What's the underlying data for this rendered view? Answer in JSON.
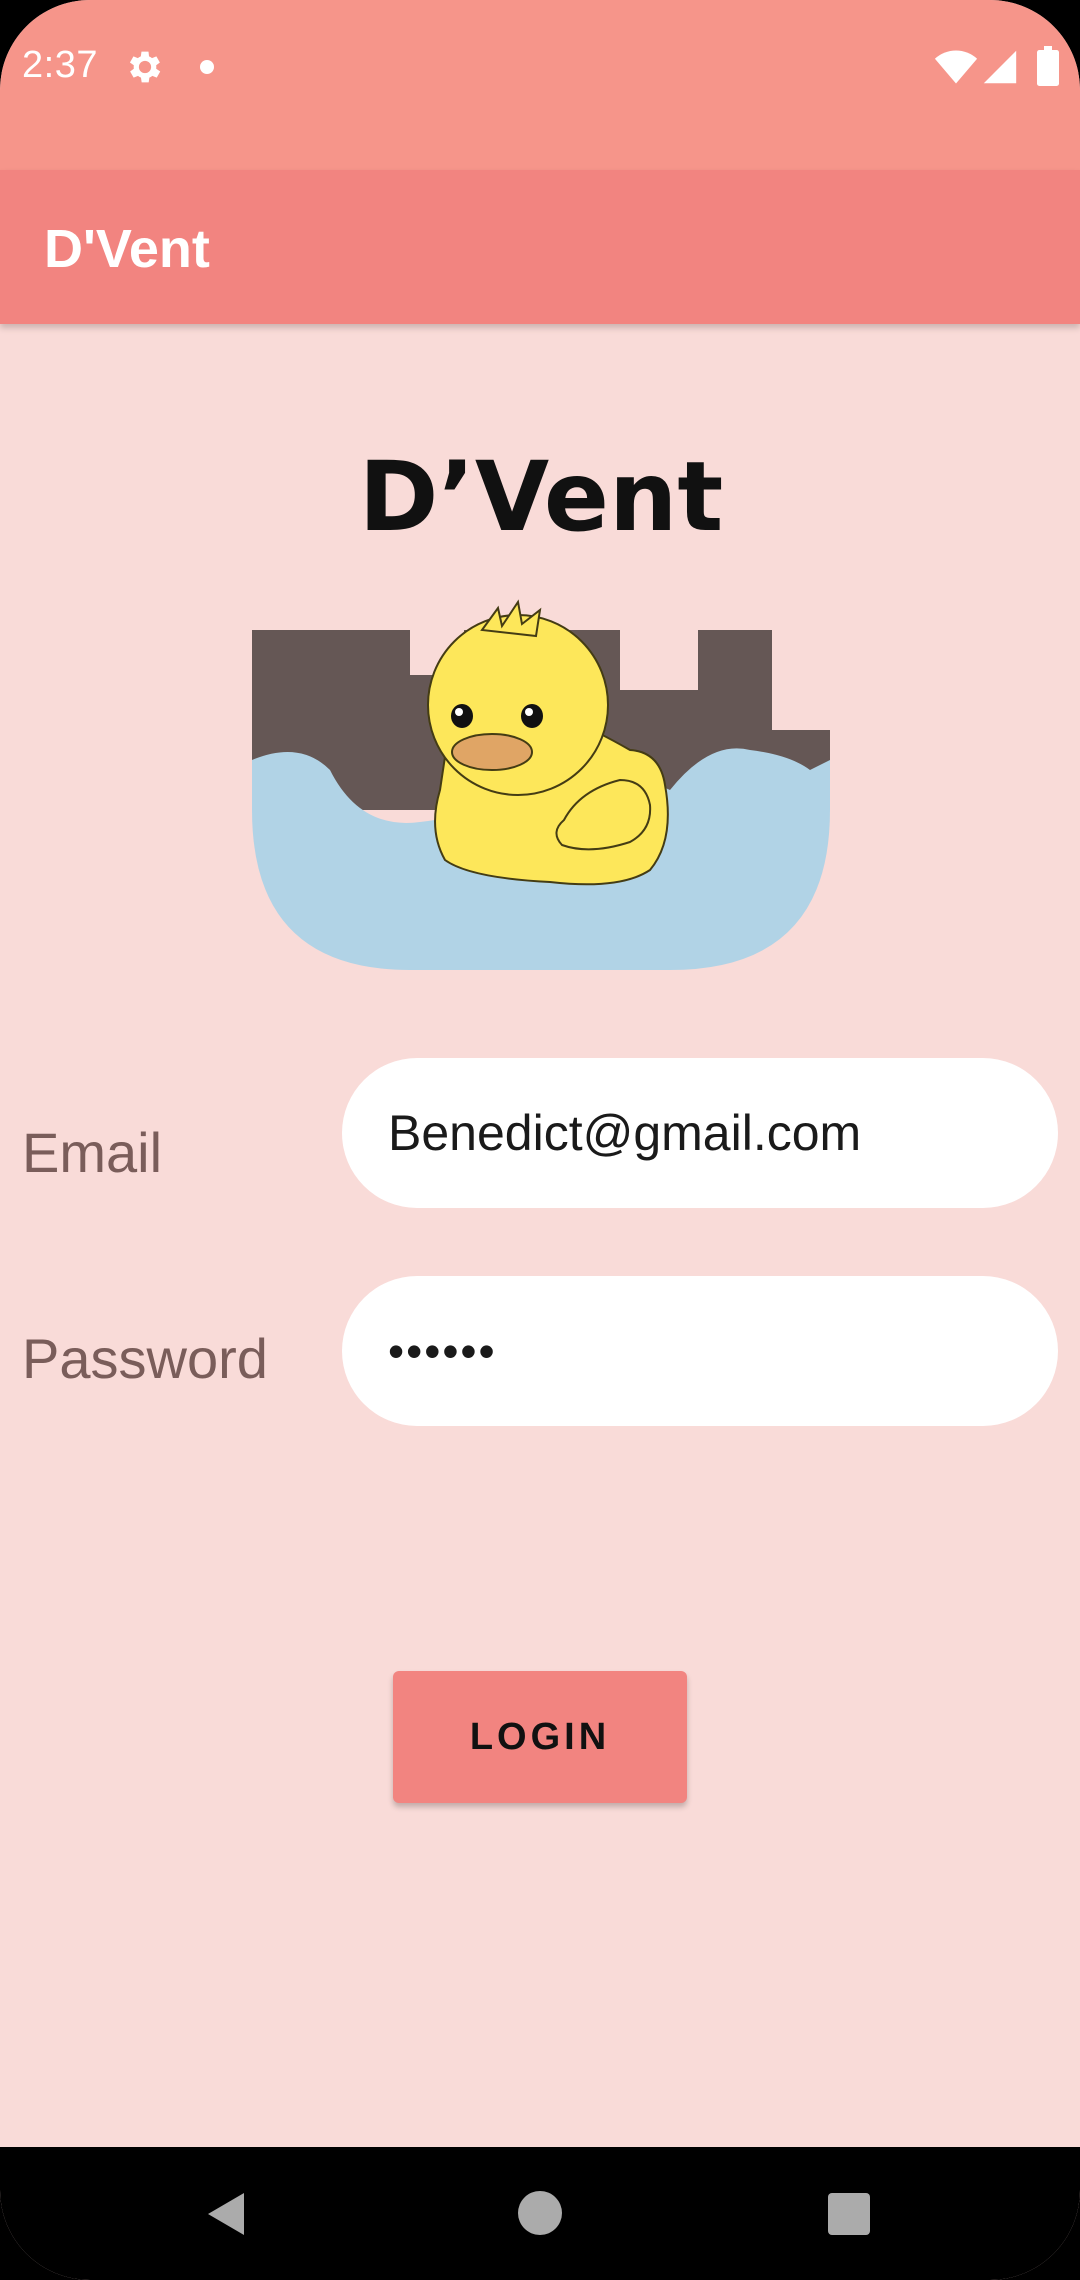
{
  "status_bar": {
    "time": "2:37",
    "icons": [
      "gear-icon",
      "notification-dot-icon",
      "wifi-icon",
      "signal-icon",
      "battery-icon"
    ]
  },
  "app_bar": {
    "title": "D'Vent"
  },
  "logo": {
    "text": "D’Vent",
    "icon": "duck-logo-icon"
  },
  "form": {
    "email_label": "Email",
    "email_value": "Benedict@gmail.com",
    "password_label": "Password",
    "password_value": "••••••",
    "login_label": "LOGIN"
  },
  "nav_bar": {
    "icons": [
      "back-icon",
      "home-icon",
      "recents-icon"
    ]
  },
  "colors": {
    "status_bar": "#f6958a",
    "app_bar": "#f28480",
    "background": "#f9dbd8",
    "button": "#f28480",
    "field": "#ffffff",
    "label": "#7a5d5a"
  }
}
